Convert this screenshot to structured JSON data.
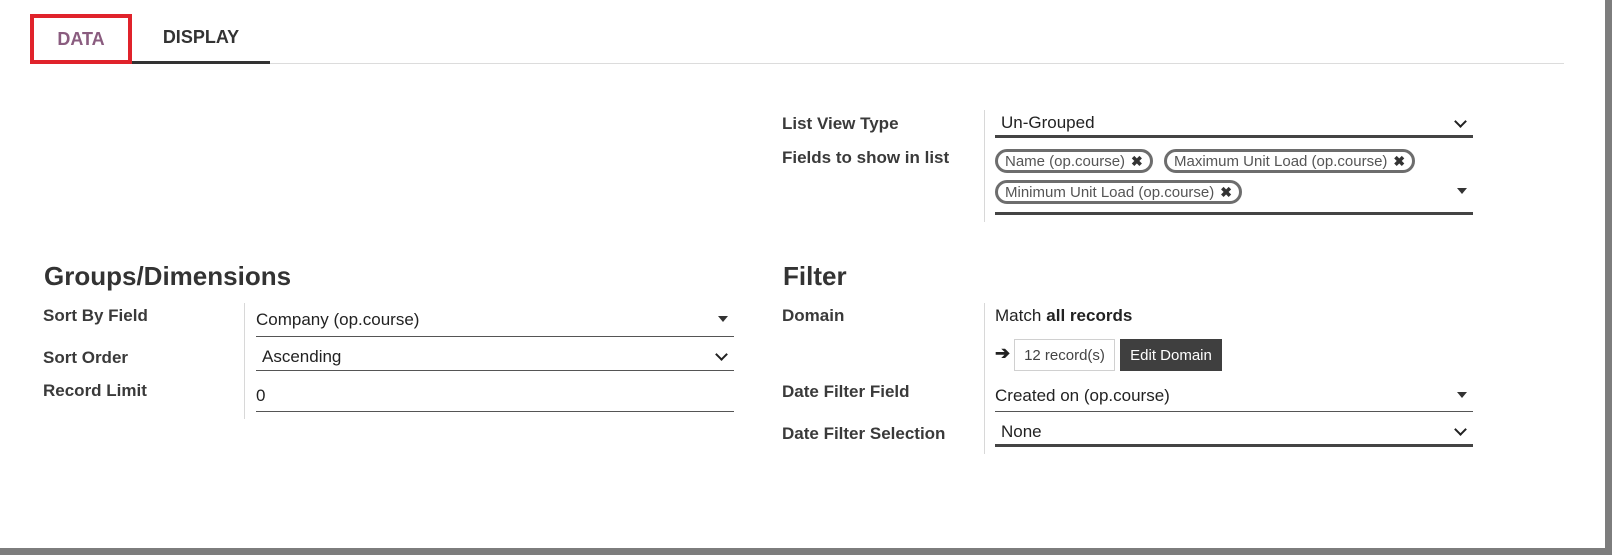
{
  "tabs": [
    {
      "label": "DATA",
      "active": true,
      "highlighted": true
    },
    {
      "label": "DISPLAY",
      "active": false
    }
  ],
  "colors": {
    "active_tab": "#8a5c7f",
    "highlight_box": "#e0232b",
    "edit_button_bg": "#3f3f3f"
  },
  "list_view": {
    "type_label": "List View Type",
    "type_value": "Un-Grouped",
    "fields_label": "Fields to show in list",
    "fields": [
      "Name (op.course)",
      "Maximum Unit Load (op.course)",
      "Minimum Unit Load (op.course)"
    ]
  },
  "groups": {
    "heading": "Groups/Dimensions",
    "sort_by_label": "Sort By Field",
    "sort_by_value": "Company (op.course)",
    "sort_order_label": "Sort Order",
    "sort_order_value": "Ascending",
    "record_limit_label": "Record Limit",
    "record_limit_value": "0"
  },
  "filter": {
    "heading": "Filter",
    "domain_label": "Domain",
    "domain_match_prefix": "Match",
    "domain_match_bold": "all records",
    "record_count": "12 record(s)",
    "edit_domain_label": "Edit Domain",
    "date_field_label": "Date Filter Field",
    "date_field_value": "Created on (op.course)",
    "date_selection_label": "Date Filter Selection",
    "date_selection_value": "None"
  },
  "icons": {
    "remove_tag": "✖",
    "arrow": "➔"
  }
}
